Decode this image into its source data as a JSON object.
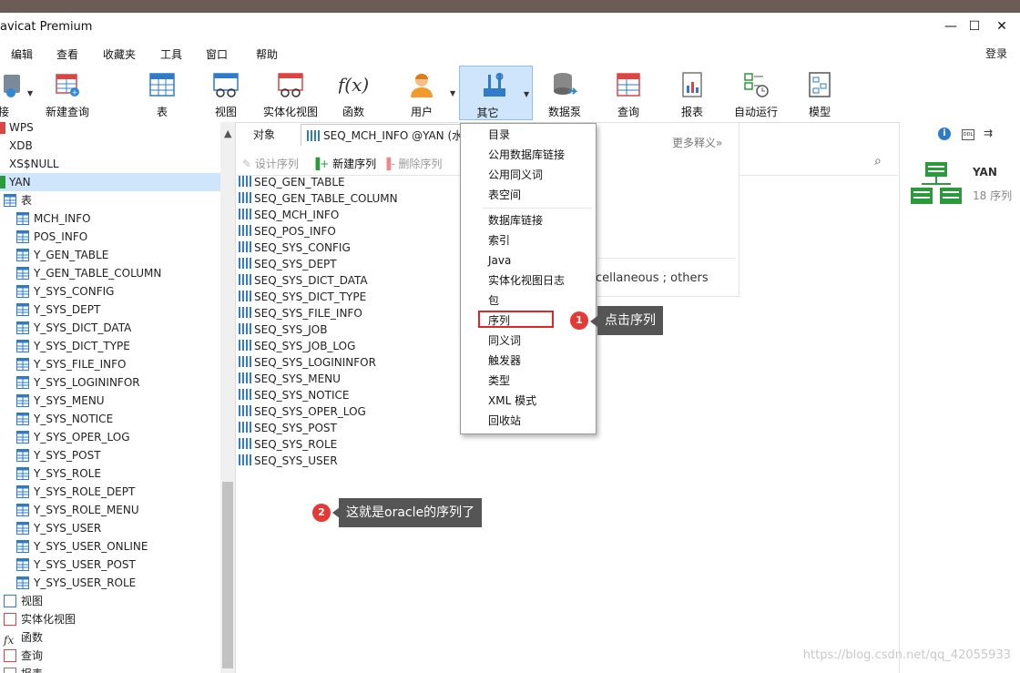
{
  "window": {
    "title": "avicat Premium",
    "controls": [
      "—",
      "☐",
      "✕"
    ]
  },
  "menu": [
    "编辑",
    "查看",
    "收藏夹",
    "工具",
    "窗口",
    "帮助"
  ],
  "login_label": "登录",
  "toolbar": [
    {
      "label": "接",
      "icon": "connection-icon"
    },
    {
      "label": "新建查询",
      "icon": "new-query-icon"
    },
    {
      "label": "表",
      "icon": "table-icon"
    },
    {
      "label": "视图",
      "icon": "view-icon"
    },
    {
      "label": "实体化视图",
      "icon": "materialized-view-icon"
    },
    {
      "label": "函数",
      "icon": "function-icon"
    },
    {
      "label": "用户",
      "icon": "user-icon"
    },
    {
      "label": "其它",
      "icon": "other-tools-icon",
      "active": true
    },
    {
      "label": "数据泵",
      "icon": "data-pump-icon"
    },
    {
      "label": "查询",
      "icon": "query-icon"
    },
    {
      "label": "报表",
      "icon": "report-icon"
    },
    {
      "label": "自动运行",
      "icon": "automation-icon"
    },
    {
      "label": "模型",
      "icon": "model-icon"
    }
  ],
  "sidebar": {
    "schemas": [
      "WPS",
      "XDB",
      "XS$NULL",
      "YAN"
    ],
    "tables_label": "表",
    "tables": [
      "MCH_INFO",
      "POS_INFO",
      "Y_GEN_TABLE",
      "Y_GEN_TABLE_COLUMN",
      "Y_SYS_CONFIG",
      "Y_SYS_DEPT",
      "Y_SYS_DICT_DATA",
      "Y_SYS_DICT_TYPE",
      "Y_SYS_FILE_INFO",
      "Y_SYS_LOGININFOR",
      "Y_SYS_MENU",
      "Y_SYS_NOTICE",
      "Y_SYS_OPER_LOG",
      "Y_SYS_POST",
      "Y_SYS_ROLE",
      "Y_SYS_ROLE_DEPT",
      "Y_SYS_ROLE_MENU",
      "Y_SYS_USER",
      "Y_SYS_USER_ONLINE",
      "Y_SYS_USER_POST",
      "Y_SYS_USER_ROLE"
    ],
    "groups": [
      "视图",
      "实体化视图",
      "函数",
      "查询",
      "报表"
    ]
  },
  "tabs": {
    "objects": "对象",
    "active_tab": "SEQ_MCH_INFO @YAN (水"
  },
  "subtoolbar": {
    "design": "设计序列",
    "new": "新建序列",
    "delete": "删除序列"
  },
  "sequences": [
    "SEQ_GEN_TABLE",
    "SEQ_GEN_TABLE_COLUMN",
    "SEQ_MCH_INFO",
    "SEQ_POS_INFO",
    "SEQ_SYS_CONFIG",
    "SEQ_SYS_DEPT",
    "SEQ_SYS_DICT_DATA",
    "SEQ_SYS_DICT_TYPE",
    "SEQ_SYS_FILE_INFO",
    "SEQ_SYS_JOB",
    "SEQ_SYS_JOB_LOG",
    "SEQ_SYS_LOGININFOR",
    "SEQ_SYS_MENU",
    "SEQ_SYS_NOTICE",
    "SEQ_SYS_OPER_LOG",
    "SEQ_SYS_POST",
    "SEQ_SYS_ROLE",
    "SEQ_SYS_USER"
  ],
  "info_popup": {
    "more": "更多释义»",
    "text": "cellaneous ; others"
  },
  "dropdown": {
    "group1": [
      "目录",
      "公用数据库链接",
      "公用同义词",
      "表空间"
    ],
    "group2": [
      "数据库链接",
      "索引",
      "Java",
      "实体化视图日志",
      "包",
      "序列",
      "同义词",
      "触发器",
      "类型",
      "XML 模式",
      "回收站"
    ]
  },
  "annotations": [
    {
      "number": "1",
      "text": "点击序列"
    },
    {
      "number": "2",
      "text": "这就是oracle的序列了"
    }
  ],
  "right_panel": {
    "schema": "YAN",
    "count": "18 序列"
  },
  "watermark": "https://blog.csdn.net/qq_42055933",
  "colors": {
    "accent": "#cfe5fb",
    "highlight": "#e0262a",
    "badge": "#e53935",
    "callout": "#555555"
  }
}
